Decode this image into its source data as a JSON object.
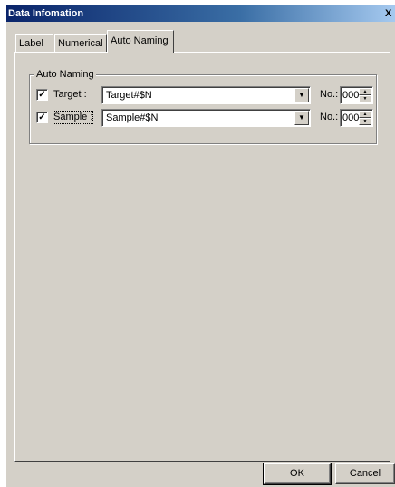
{
  "window": {
    "title": "Data Infomation",
    "close_glyph": "X"
  },
  "tabs": [
    {
      "label": "Label"
    },
    {
      "label": "Numerical"
    },
    {
      "label": "Auto Naming"
    }
  ],
  "auto_naming": {
    "group_label": "Auto Naming",
    "rows": [
      {
        "checked": true,
        "check_glyph": "✓",
        "label": "Target :",
        "combo_value": "Target#$N",
        "no_label": "No.:",
        "no_value": "000"
      },
      {
        "checked": true,
        "check_glyph": "✓",
        "label": "Sample :",
        "combo_value": "Sample#$N",
        "no_label": "No.:",
        "no_value": "000"
      }
    ]
  },
  "footer": {
    "ok_label": "OK",
    "cancel_label": "Cancel"
  }
}
